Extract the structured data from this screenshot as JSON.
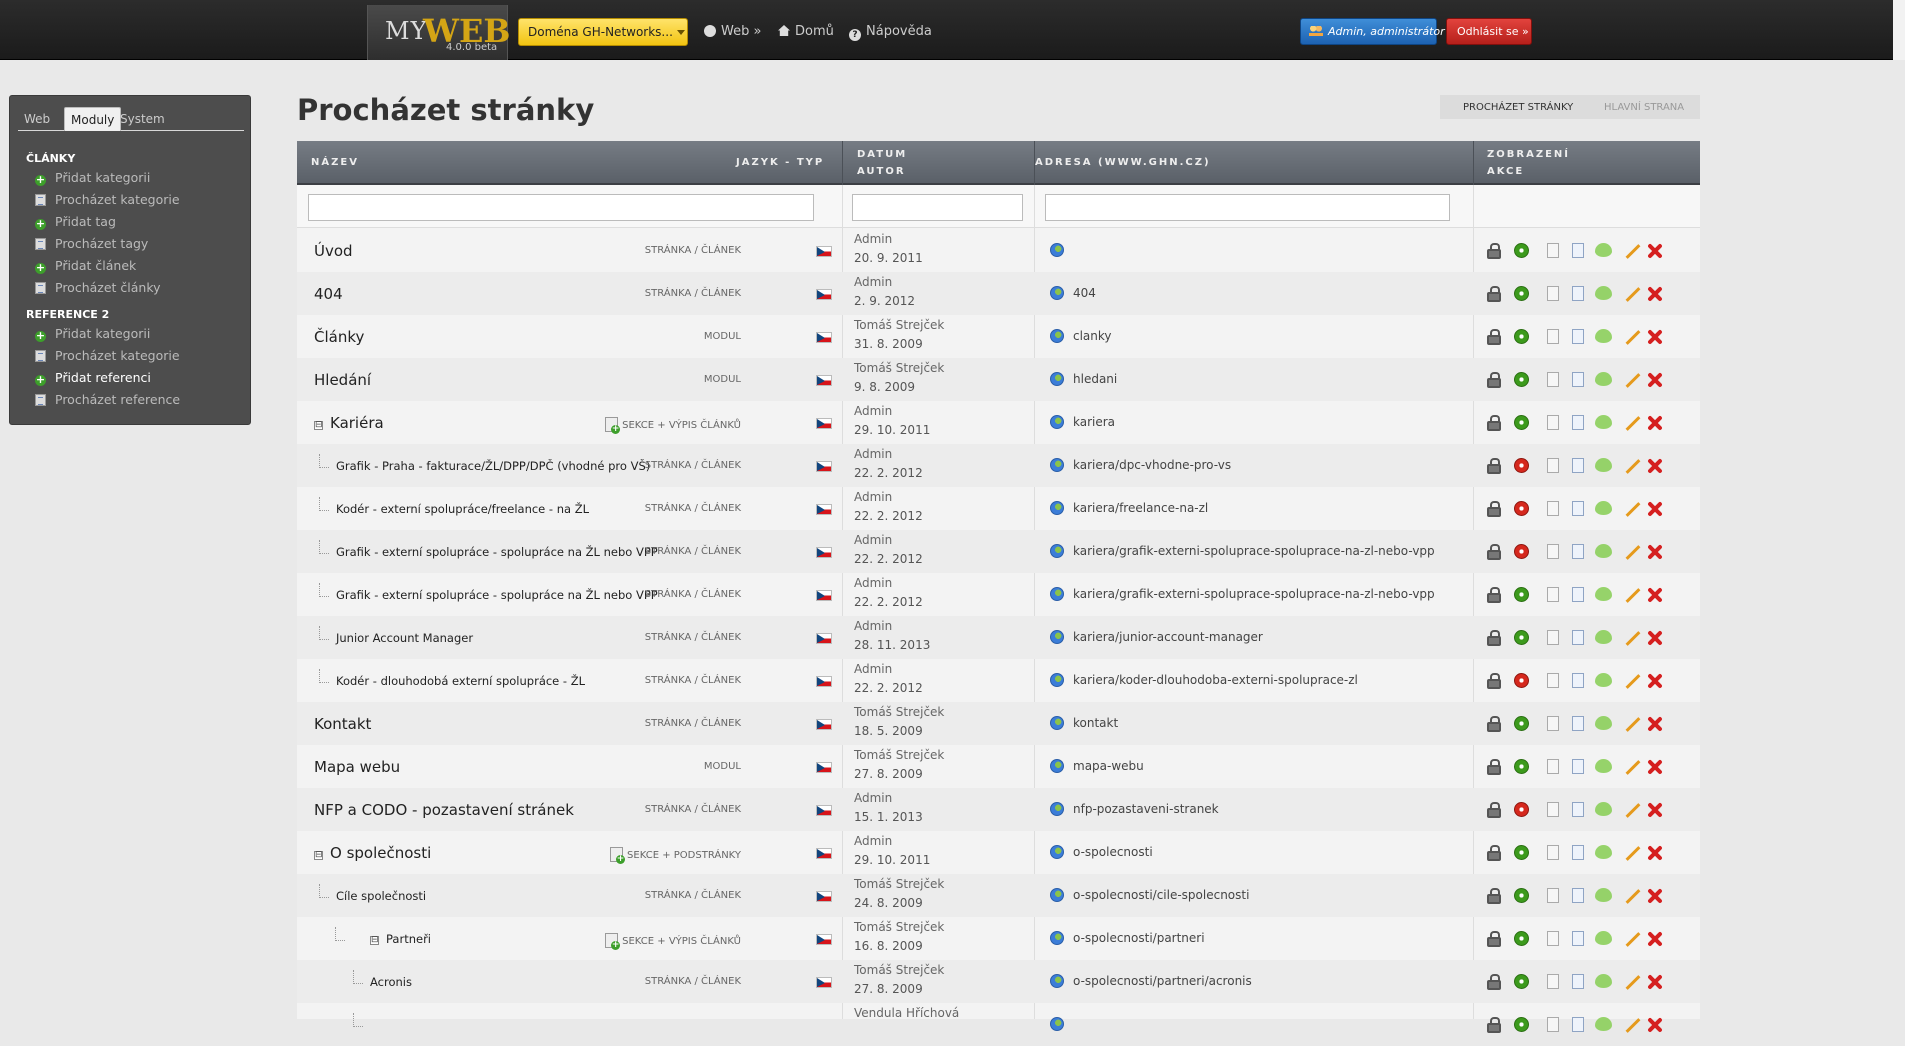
{
  "header": {
    "logo_my": "MY",
    "logo_web": "WEB",
    "logo_version": "4.0.0 beta",
    "domain_button": "Doména GH-Networks...",
    "nav": {
      "web": "Web »",
      "home": "Domů",
      "help": "Nápověda"
    },
    "user_button": "Admin, administrátor",
    "logout_button": "Odhlásit se »"
  },
  "sidebar": {
    "tabs": [
      "Web",
      "Moduly",
      "System"
    ],
    "active_tab": "Moduly",
    "sections": [
      {
        "title": "ČLÁNKY",
        "items": [
          {
            "label": "Přidat kategorii",
            "icon": "plus-icon"
          },
          {
            "label": "Procházet kategorie",
            "icon": "list-icon"
          },
          {
            "label": "Přidat tag",
            "icon": "plus-icon"
          },
          {
            "label": "Procházet tagy",
            "icon": "list-icon"
          },
          {
            "label": "Přidat článek",
            "icon": "plus-icon"
          },
          {
            "label": "Procházet články",
            "icon": "list-icon"
          }
        ]
      },
      {
        "title": "REFERENCE 2",
        "items": [
          {
            "label": "Přidat kategorii",
            "icon": "plus-icon"
          },
          {
            "label": "Procházet kategorie",
            "icon": "list-icon"
          },
          {
            "label": "Přidat referenci",
            "icon": "plus-icon"
          },
          {
            "label": "Procházet reference",
            "icon": "list-icon"
          }
        ]
      }
    ]
  },
  "page": {
    "title": "Procházet stránky",
    "breadcrumbs": [
      "Procházet stránky",
      "Hlavní strana"
    ]
  },
  "table": {
    "headers": {
      "name": "Název",
      "lang_type": "Jazyk - typ",
      "date": "Datum",
      "author": "Autor",
      "address": "Adresa (www.ghn.cz)",
      "display": "Zobrazení",
      "actions": "Akce"
    },
    "rows": [
      {
        "name": "Úvod",
        "level": 0,
        "type": "STRÁNKA / ČLÁNEK",
        "author": "Admin",
        "date": "20. 9. 2011",
        "address": "",
        "active": true
      },
      {
        "name": "404",
        "level": 0,
        "type": "STRÁNKA / ČLÁNEK",
        "author": "Admin",
        "date": "2. 9. 2012",
        "address": "404",
        "active": true
      },
      {
        "name": "Články",
        "level": 0,
        "type": "MODUL",
        "author": "Tomáš Strejček",
        "date": "31. 8. 2009",
        "address": "clanky",
        "active": true
      },
      {
        "name": "Hledání",
        "level": 0,
        "type": "MODUL",
        "author": "Tomáš Strejček",
        "date": "9. 8. 2009",
        "address": "hledani",
        "active": true
      },
      {
        "name": "Kariéra",
        "level": 0,
        "expand": "⊟",
        "type": "SEKCE + VÝPIS ČLÁNKŮ",
        "section": true,
        "author": "Admin",
        "date": "29. 10. 2011",
        "address": "kariera",
        "active": true
      },
      {
        "name": "Grafik - Praha - fakturace/ŽL/DPP/DPČ (vhodné pro VŠ)",
        "level": 1,
        "type": "STRÁNKA / ČLÁNEK",
        "author": "Admin",
        "date": "22. 2. 2012",
        "address": "kariera/dpc-vhodne-pro-vs",
        "active": false
      },
      {
        "name": "Kodér - externí spolupráce/freelance - na ŽL",
        "level": 1,
        "type": "STRÁNKA / ČLÁNEK",
        "author": "Admin",
        "date": "22. 2. 2012",
        "address": "kariera/freelance-na-zl",
        "active": false
      },
      {
        "name": "Grafik - externí spolupráce - spolupráce na ŽL nebo VPP",
        "level": 1,
        "type": "STRÁNKA / ČLÁNEK",
        "author": "Admin",
        "date": "22. 2. 2012",
        "address": "kariera/grafik-externi-spoluprace-spoluprace-na-zl-nebo-vpp",
        "active": false
      },
      {
        "name": "Grafik - externí spolupráce - spolupráce na ŽL nebo VPP",
        "level": 1,
        "type": "STRÁNKA / ČLÁNEK",
        "author": "Admin",
        "date": "22. 2. 2012",
        "address": "kariera/grafik-externi-spoluprace-spoluprace-na-zl-nebo-vpp",
        "active": true
      },
      {
        "name": "Junior Account Manager",
        "level": 1,
        "type": "STRÁNKA / ČLÁNEK",
        "author": "Admin",
        "date": "28. 11. 2013",
        "address": "kariera/junior-account-manager",
        "active": true
      },
      {
        "name": "Kodér - dlouhodobá externí spolupráce - ŽL",
        "level": 1,
        "type": "STRÁNKA / ČLÁNEK",
        "author": "Admin",
        "date": "22. 2. 2012",
        "address": "kariera/koder-dlouhodoba-externi-spoluprace-zl",
        "active": false
      },
      {
        "name": "Kontakt",
        "level": 0,
        "type": "STRÁNKA / ČLÁNEK",
        "author": "Tomáš Strejček",
        "date": "18. 5. 2009",
        "address": "kontakt",
        "active": true
      },
      {
        "name": "Mapa webu",
        "level": 0,
        "type": "MODUL",
        "author": "Tomáš Strejček",
        "date": "27. 8. 2009",
        "address": "mapa-webu",
        "active": true
      },
      {
        "name": "NFP a CODO - pozastavení stránek",
        "level": 0,
        "type": "STRÁNKA / ČLÁNEK",
        "author": "Admin",
        "date": "15. 1. 2013",
        "address": "nfp-pozastaveni-stranek",
        "active": false
      },
      {
        "name": "O společnosti",
        "level": 0,
        "expand": "⊟",
        "type": "SEKCE + PODSTRÁNKY",
        "section": true,
        "author": "Admin",
        "date": "29. 10. 2011",
        "address": "o-spolecnosti",
        "active": true
      },
      {
        "name": "Cíle společnosti",
        "level": 1,
        "type": "STRÁNKA / ČLÁNEK",
        "author": "Tomáš Strejček",
        "date": "24. 8. 2009",
        "address": "o-spolecnosti/cile-spolecnosti",
        "active": true
      },
      {
        "name": "Partneři",
        "level": 2,
        "expand": "⊟",
        "type": "SEKCE + VÝPIS ČLÁNKŮ",
        "section": true,
        "author": "Tomáš Strejček",
        "date": "16. 8. 2009",
        "address": "o-spolecnosti/partneri",
        "active": true
      },
      {
        "name": "Acronis",
        "level": 3,
        "type": "STRÁNKA / ČLÁNEK",
        "author": "Tomáš Strejček",
        "date": "27. 8. 2009",
        "address": "o-spolecnosti/partneri/acronis",
        "active": true
      },
      {
        "name": "",
        "level": 3,
        "type": "",
        "author": "Vendula Hříchová",
        "date": "",
        "address": "",
        "active": true
      }
    ]
  },
  "colors": {
    "topbar": "#1f1f1f",
    "domain_button": "#f2c412",
    "user_button": "#1d62b2",
    "logout_button": "#c4241f",
    "active_status": "#3c9a1c",
    "inactive_status": "#d5281d"
  }
}
